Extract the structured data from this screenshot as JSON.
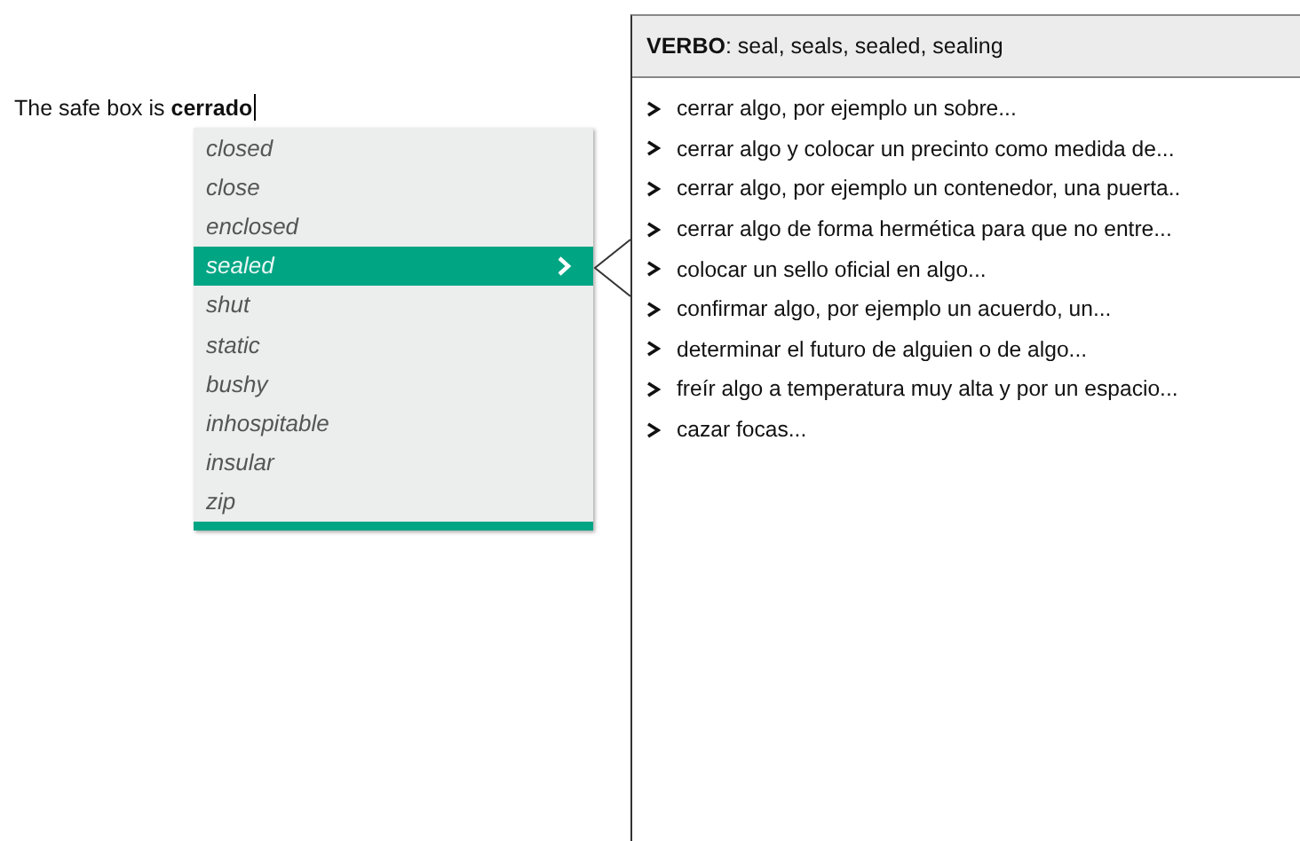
{
  "document": {
    "text": "The safe box is **cerrado**"
  },
  "suggestions": [
    {
      "label": "closed",
      "selected": false
    },
    {
      "label": "close",
      "selected": false
    },
    {
      "label": "enclosed",
      "selected": false
    },
    {
      "label": "sealed",
      "selected": true
    },
    {
      "label": "shut",
      "selected": false
    },
    {
      "label": "static",
      "selected": false
    },
    {
      "label": "bushy",
      "selected": false
    },
    {
      "label": "inhospitable",
      "selected": false
    },
    {
      "label": "insular",
      "selected": false
    },
    {
      "label": "zip",
      "selected": false
    }
  ],
  "definition_panel": {
    "header": "**VERBO**: seal, seals, sealed, sealing",
    "senses": [
      "cerrar algo, por ejemplo un sobre...",
      "cerrar algo y colocar un precinto como medida de...",
      "cerrar algo, por ejemplo un contenedor, una puerta..",
      "cerrar algo de forma hermética para que no entre...",
      "colocar un sello oficial en algo...",
      "confirmar algo, por ejemplo un acuerdo, un...",
      "determinar el futuro de alguien o de algo...",
      "freír algo a temperatura muy alta y por un espacio...",
      "cazar focas..."
    ]
  }
}
